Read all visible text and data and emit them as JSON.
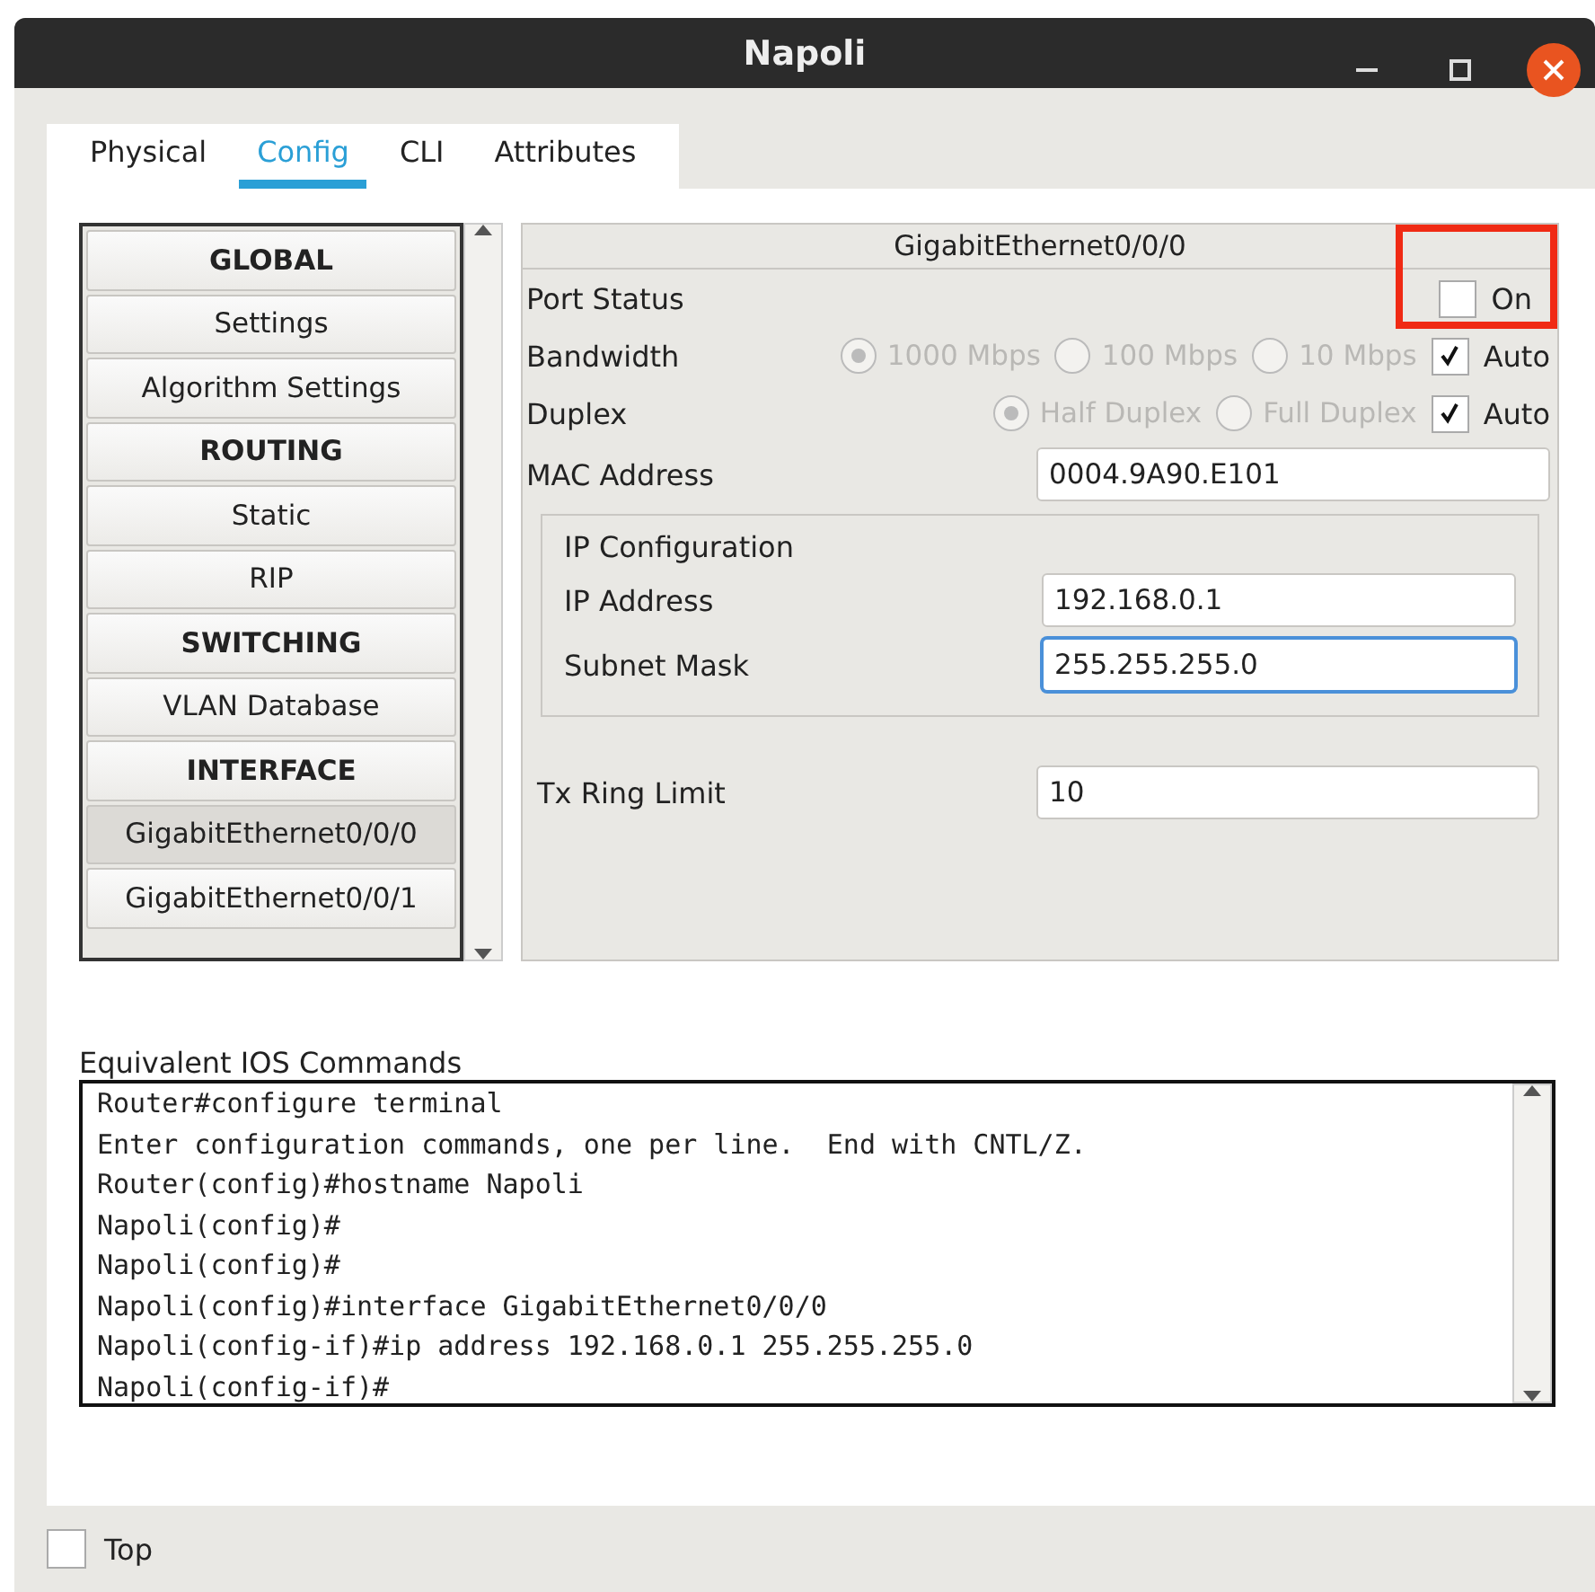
{
  "window": {
    "title": "Napoli"
  },
  "tabs": [
    {
      "label": "Physical",
      "selected": false
    },
    {
      "label": "Config",
      "selected": true
    },
    {
      "label": "CLI",
      "selected": false
    },
    {
      "label": "Attributes",
      "selected": false
    }
  ],
  "menu": [
    {
      "label": "GLOBAL",
      "kind": "header",
      "selected": false
    },
    {
      "label": "Settings",
      "kind": "item",
      "selected": false
    },
    {
      "label": "Algorithm Settings",
      "kind": "item",
      "selected": false
    },
    {
      "label": "ROUTING",
      "kind": "header",
      "selected": false
    },
    {
      "label": "Static",
      "kind": "item",
      "selected": false
    },
    {
      "label": "RIP",
      "kind": "item",
      "selected": false
    },
    {
      "label": "SWITCHING",
      "kind": "header",
      "selected": false
    },
    {
      "label": "VLAN Database",
      "kind": "item",
      "selected": false
    },
    {
      "label": "INTERFACE",
      "kind": "header",
      "selected": false
    },
    {
      "label": "GigabitEthernet0/0/0",
      "kind": "item",
      "selected": true
    },
    {
      "label": "GigabitEthernet0/0/1",
      "kind": "item",
      "selected": false
    }
  ],
  "interface_panel": {
    "title": "GigabitEthernet0/0/0",
    "port_status": {
      "label": "Port Status",
      "toggle_label": "On",
      "checked": false
    },
    "settings": [
      {
        "label": "Bandwidth",
        "disabled": true,
        "options": [
          {
            "label": "1000 Mbps",
            "selected": true
          },
          {
            "label": "100 Mbps",
            "selected": false
          },
          {
            "label": "10 Mbps",
            "selected": false
          }
        ],
        "auto": {
          "label": "Auto",
          "checked": true
        }
      },
      {
        "label": "Duplex",
        "disabled": true,
        "options": [
          {
            "label": "Half Duplex",
            "selected": true
          },
          {
            "label": "Full Duplex",
            "selected": false
          }
        ],
        "auto": {
          "label": "Auto",
          "checked": true
        }
      }
    ],
    "mac": {
      "label": "MAC Address",
      "value": "0004.9A90.E101"
    },
    "ip_config": {
      "title": "IP Configuration",
      "fields": [
        {
          "label": "IP Address",
          "value": "192.168.0.1",
          "focused": false
        },
        {
          "label": "Subnet Mask",
          "value": "255.255.255.0",
          "focused": true
        }
      ]
    },
    "tx_ring": {
      "label": "Tx Ring Limit",
      "value": "10"
    }
  },
  "commands": {
    "label": "Equivalent IOS Commands",
    "lines": [
      "Router#configure terminal",
      "Enter configuration commands, one per line.  End with CNTL/Z.",
      "Router(config)#hostname Napoli",
      "Napoli(config)#",
      "Napoli(config)#",
      "Napoli(config)#interface GigabitEthernet0/0/0",
      "Napoli(config-if)#ip address 192.168.0.1 255.255.255.0",
      "Napoli(config-if)#"
    ]
  },
  "top": {
    "label": "Top",
    "checked": false
  }
}
